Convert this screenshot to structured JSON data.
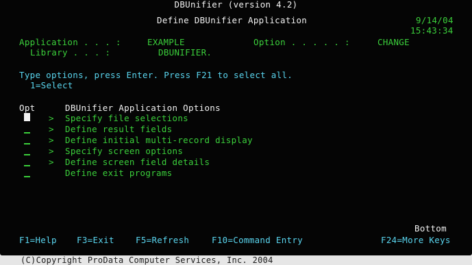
{
  "window": {
    "title": "DBUnifier (version 4.2)"
  },
  "header": {
    "screen_title": "Define DBUnifier Application",
    "date": "9/14/04",
    "time": "15:43:34"
  },
  "fields": {
    "application_label": "Application . . . :",
    "application_value": "EXAMPLE",
    "option_label": "Option . . . . . :",
    "option_value": "CHANGE",
    "library_label": "Library . . . :",
    "library_value": "DBUNIFIER."
  },
  "instructions": {
    "line1": "Type options, press Enter. Press F21 to select all.",
    "line2": "1=Select"
  },
  "list": {
    "opt_header": "Opt",
    "title_header": "DBUnifier Application Options",
    "items": [
      {
        "marker": ">",
        "label": "Specify file selections"
      },
      {
        "marker": ">",
        "label": "Define result fields"
      },
      {
        "marker": ">",
        "label": "Define initial multi-record display"
      },
      {
        "marker": ">",
        "label": "Specify screen options"
      },
      {
        "marker": ">",
        "label": "Define screen field details"
      },
      {
        "marker": "",
        "label": "Define exit programs"
      }
    ],
    "bottom_indicator": "Bottom"
  },
  "function_keys": {
    "f1": "F1=Help",
    "f3": "F3=Exit",
    "f5": "F5=Refresh",
    "f10": "F10=Command Entry",
    "f24": "F24=More Keys"
  },
  "footer": {
    "copyright": "(C)Copyright ProData Computer Services, Inc. 2004"
  },
  "colors": {
    "background": "#050505",
    "text_white": "#f2f2f2",
    "text_green": "#3bd03b",
    "text_cyan": "#5ad6f0"
  }
}
